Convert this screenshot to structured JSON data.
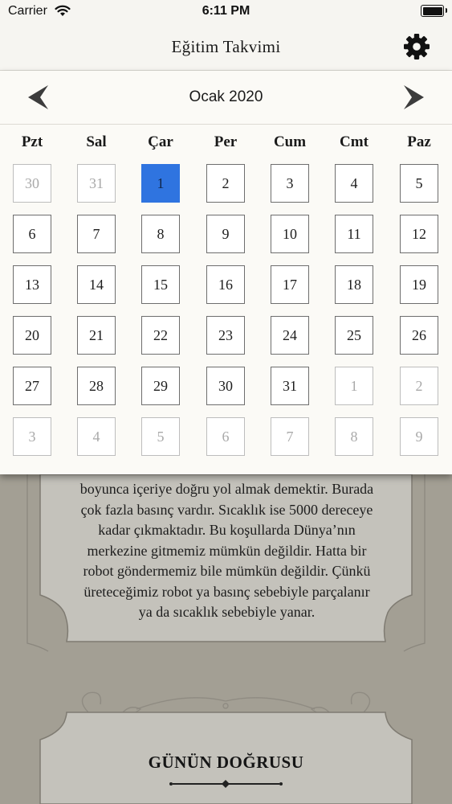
{
  "status_bar": {
    "carrier": "Carrier",
    "time": "6:11 PM"
  },
  "nav": {
    "title": "Eğitim Takvimi",
    "settings_icon": "gear-icon"
  },
  "calendar": {
    "month_label": "Ocak 2020",
    "prev_icon": "chevron-left-icon",
    "next_icon": "chevron-right-icon",
    "weekdays": [
      "Pzt",
      "Sal",
      "Çar",
      "Per",
      "Cum",
      "Cmt",
      "Paz"
    ],
    "days": [
      {
        "label": "30",
        "in_month": false
      },
      {
        "label": "31",
        "in_month": false
      },
      {
        "label": "1",
        "in_month": true,
        "selected": true
      },
      {
        "label": "2",
        "in_month": true
      },
      {
        "label": "3",
        "in_month": true
      },
      {
        "label": "4",
        "in_month": true
      },
      {
        "label": "5",
        "in_month": true
      },
      {
        "label": "6",
        "in_month": true
      },
      {
        "label": "7",
        "in_month": true
      },
      {
        "label": "8",
        "in_month": true
      },
      {
        "label": "9",
        "in_month": true
      },
      {
        "label": "10",
        "in_month": true
      },
      {
        "label": "11",
        "in_month": true
      },
      {
        "label": "12",
        "in_month": true
      },
      {
        "label": "13",
        "in_month": true
      },
      {
        "label": "14",
        "in_month": true
      },
      {
        "label": "15",
        "in_month": true
      },
      {
        "label": "16",
        "in_month": true
      },
      {
        "label": "17",
        "in_month": true
      },
      {
        "label": "18",
        "in_month": true
      },
      {
        "label": "19",
        "in_month": true
      },
      {
        "label": "20",
        "in_month": true
      },
      {
        "label": "21",
        "in_month": true
      },
      {
        "label": "22",
        "in_month": true
      },
      {
        "label": "23",
        "in_month": true
      },
      {
        "label": "24",
        "in_month": true
      },
      {
        "label": "25",
        "in_month": true
      },
      {
        "label": "26",
        "in_month": true
      },
      {
        "label": "27",
        "in_month": true
      },
      {
        "label": "28",
        "in_month": true
      },
      {
        "label": "29",
        "in_month": true
      },
      {
        "label": "30",
        "in_month": true
      },
      {
        "label": "31",
        "in_month": true
      },
      {
        "label": "1",
        "in_month": false
      },
      {
        "label": "2",
        "in_month": false
      },
      {
        "label": "3",
        "in_month": false
      },
      {
        "label": "4",
        "in_month": false
      },
      {
        "label": "5",
        "in_month": false
      },
      {
        "label": "6",
        "in_month": false
      },
      {
        "label": "7",
        "in_month": false
      },
      {
        "label": "8",
        "in_month": false
      },
      {
        "label": "9",
        "in_month": false
      }
    ],
    "colors": {
      "selected": "#2f74e0",
      "muted_text": "#a9a9a9",
      "border": "#6e6e6e"
    }
  },
  "content": {
    "article_lines": [
      "boyunca içeriye doğru yol almak demektir. Burada",
      "çok fazla basınç vardır. Sıcaklık ise 5000 dereceye",
      "kadar çıkmaktadır.  Bu koşullarda Dünya’nın",
      "merkezine gitmemiz mümkün değildir. Hatta bir",
      "robot göndermemiz bile mümkün değildir. Çünkü",
      "üreteceğimiz robot ya basınç sebebiyle parçalanır",
      "ya da sıcaklık sebebiyle yanar."
    ],
    "section_heading": "GÜNÜN DOĞRUSU"
  }
}
